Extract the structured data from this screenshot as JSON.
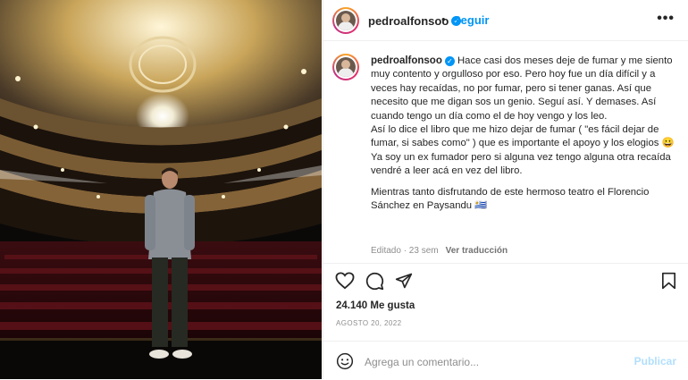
{
  "post": {
    "username": "pedroalfonsoo",
    "verified_icon": "verified-badge-icon",
    "follow_separator": "•",
    "follow_label": "Seguir",
    "more_label": "•••"
  },
  "caption": {
    "username": "pedroalfonsoo",
    "paragraph1": "Hace casi dos meses deje de fumar y me siento muy contento y orgulloso por eso. Pero hoy fue un día difícil y a veces hay recaídas, no por fumar, pero si tener ganas. Así que necesito que me digan sos un genio. Seguí así. Y demases. Así cuando tengo un día como el de hoy vengo y los leo.",
    "paragraph2": "Así lo dice el libro que me hizo dejar de fumar ( \"es fácil dejar de fumar, si sabes como\" ) que es importante el apoyo y los elogios 😀",
    "paragraph3": "Ya soy un ex fumador pero si alguna vez tengo alguna otra recaída vendré a leer acá en vez del libro.",
    "paragraph4": "Mientras tanto disfrutando de este hermoso teatro el Florencio Sánchez en Paysandu 🇺🇾"
  },
  "meta": {
    "edited": "Editado · 23 sem",
    "translate": "Ver traducción"
  },
  "actions": {
    "icons": [
      "heart-icon",
      "comment-icon",
      "share-icon",
      "bookmark-icon"
    ]
  },
  "likes": "24.140 Me gusta",
  "date": "AGOSTO 20, 2022",
  "comment_box": {
    "placeholder": "Agrega un comentario...",
    "publish_label": "Publicar",
    "emoji_icon": "emoji-icon"
  },
  "colors": {
    "accent": "#0095f6",
    "publish_disabled": "#b2dffc",
    "muted": "#8e8e8e",
    "text": "#262626"
  }
}
